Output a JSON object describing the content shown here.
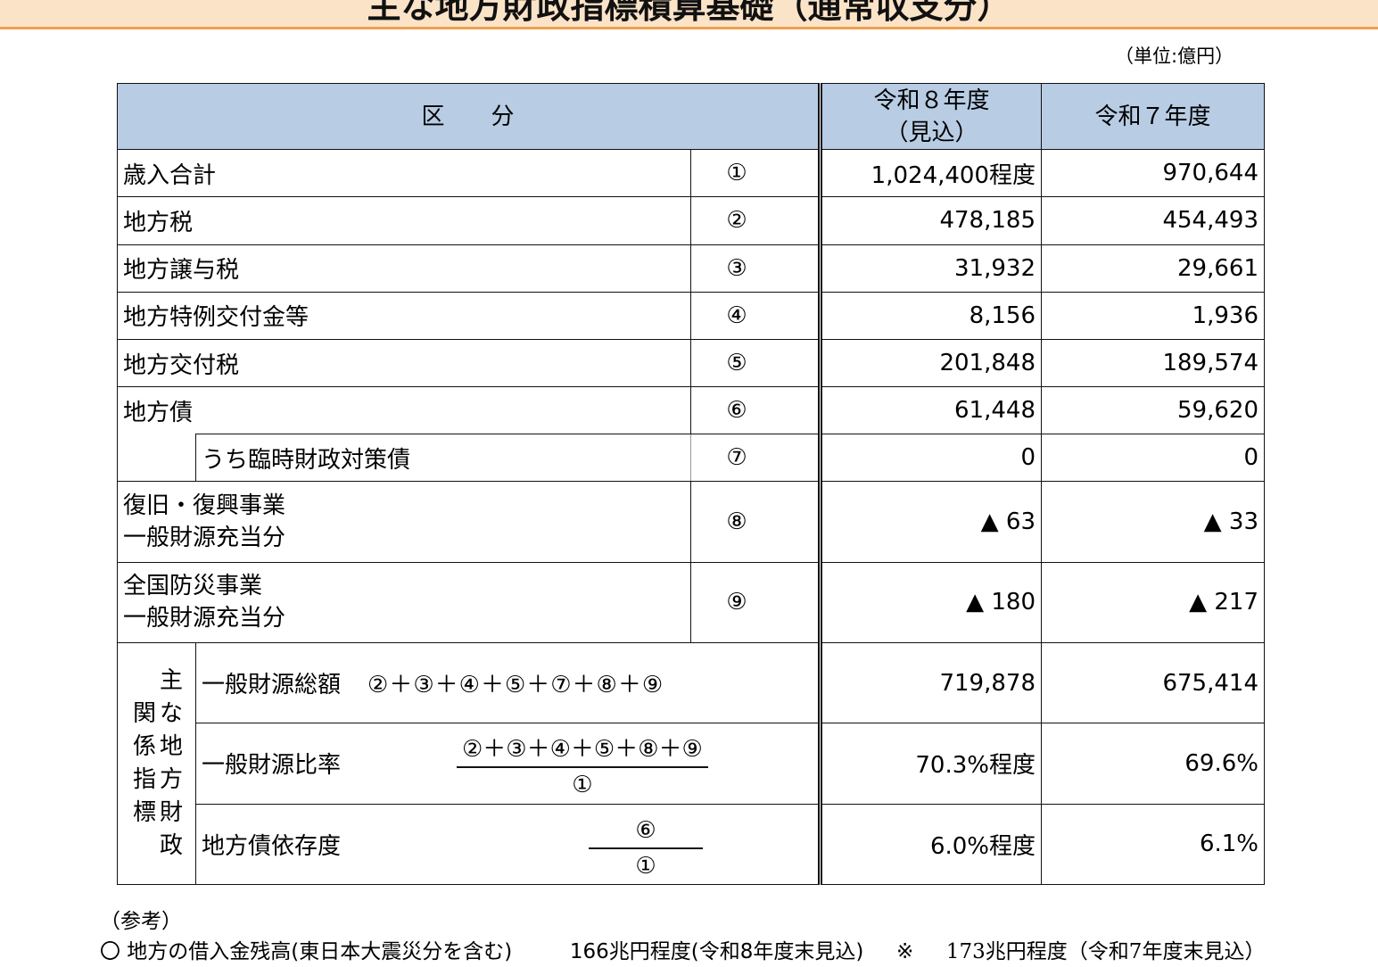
{
  "title": "主な地方財政指標積算基礎（通常収支分）",
  "unit": "（単位:億円）",
  "headers": {
    "category": "区　　分",
    "col1_line1": "令和８年度",
    "col1_line2": "（見込）",
    "col2": "令和７年度"
  },
  "rows": [
    {
      "label": "歳入合計",
      "circle": "①",
      "r8": "1,024,400程度",
      "r7": "970,644"
    },
    {
      "label": "地方税",
      "circle": "②",
      "r8": "478,185",
      "r7": "454,493"
    },
    {
      "label": "地方譲与税",
      "circle": "③",
      "r8": "31,932",
      "r7": "29,661"
    },
    {
      "label": "地方特例交付金等",
      "circle": "④",
      "r8": "8,156",
      "r7": "1,936"
    },
    {
      "label": "地方交付税",
      "circle": "⑤",
      "r8": "201,848",
      "r7": "189,574"
    },
    {
      "label": "地方債",
      "circle": "⑥",
      "r8": "61,448",
      "r7": "59,620"
    },
    {
      "label": "うち臨時財政対策債",
      "circle": "⑦",
      "r8": "0",
      "r7": "0"
    },
    {
      "label_line1": "復旧・復興事業",
      "label_line2": "一般財源充当分",
      "circle": "⑧",
      "r8": "▲ 63",
      "r7": "▲ 33"
    },
    {
      "label_line1": "全国防災事業",
      "label_line2": "一般財源充当分",
      "circle": "⑨",
      "r8": "▲ 180",
      "r7": "▲ 217"
    }
  ],
  "indicators": {
    "side_col1": [
      "関",
      "係",
      "指",
      "標"
    ],
    "side_col2": [
      "主",
      "な",
      "地",
      "方",
      "財",
      "政"
    ],
    "items": [
      {
        "label": "一般財源総額",
        "formula": "②＋③＋④＋⑤＋⑦＋⑧＋⑨",
        "r8": "719,878",
        "r7": "675,414"
      },
      {
        "label": "一般財源比率",
        "numerator": "②＋③＋④＋⑤＋⑧＋⑨",
        "denominator": "①",
        "r8": "70.3%程度",
        "r7": "69.6%"
      },
      {
        "label": "地方債依存度",
        "numerator": "⑥",
        "denominator": "①",
        "r8": "6.0%程度",
        "r7": "6.1%"
      }
    ]
  },
  "notes": {
    "heading": "（参考）",
    "line_a": "〇 地方の借入金残高(東日本大震災分を含む)",
    "line_b": "166兆円程度(令和8年度末見込)",
    "line_c": "※",
    "line_d": "173兆円程度（令和7年度末見込）"
  }
}
